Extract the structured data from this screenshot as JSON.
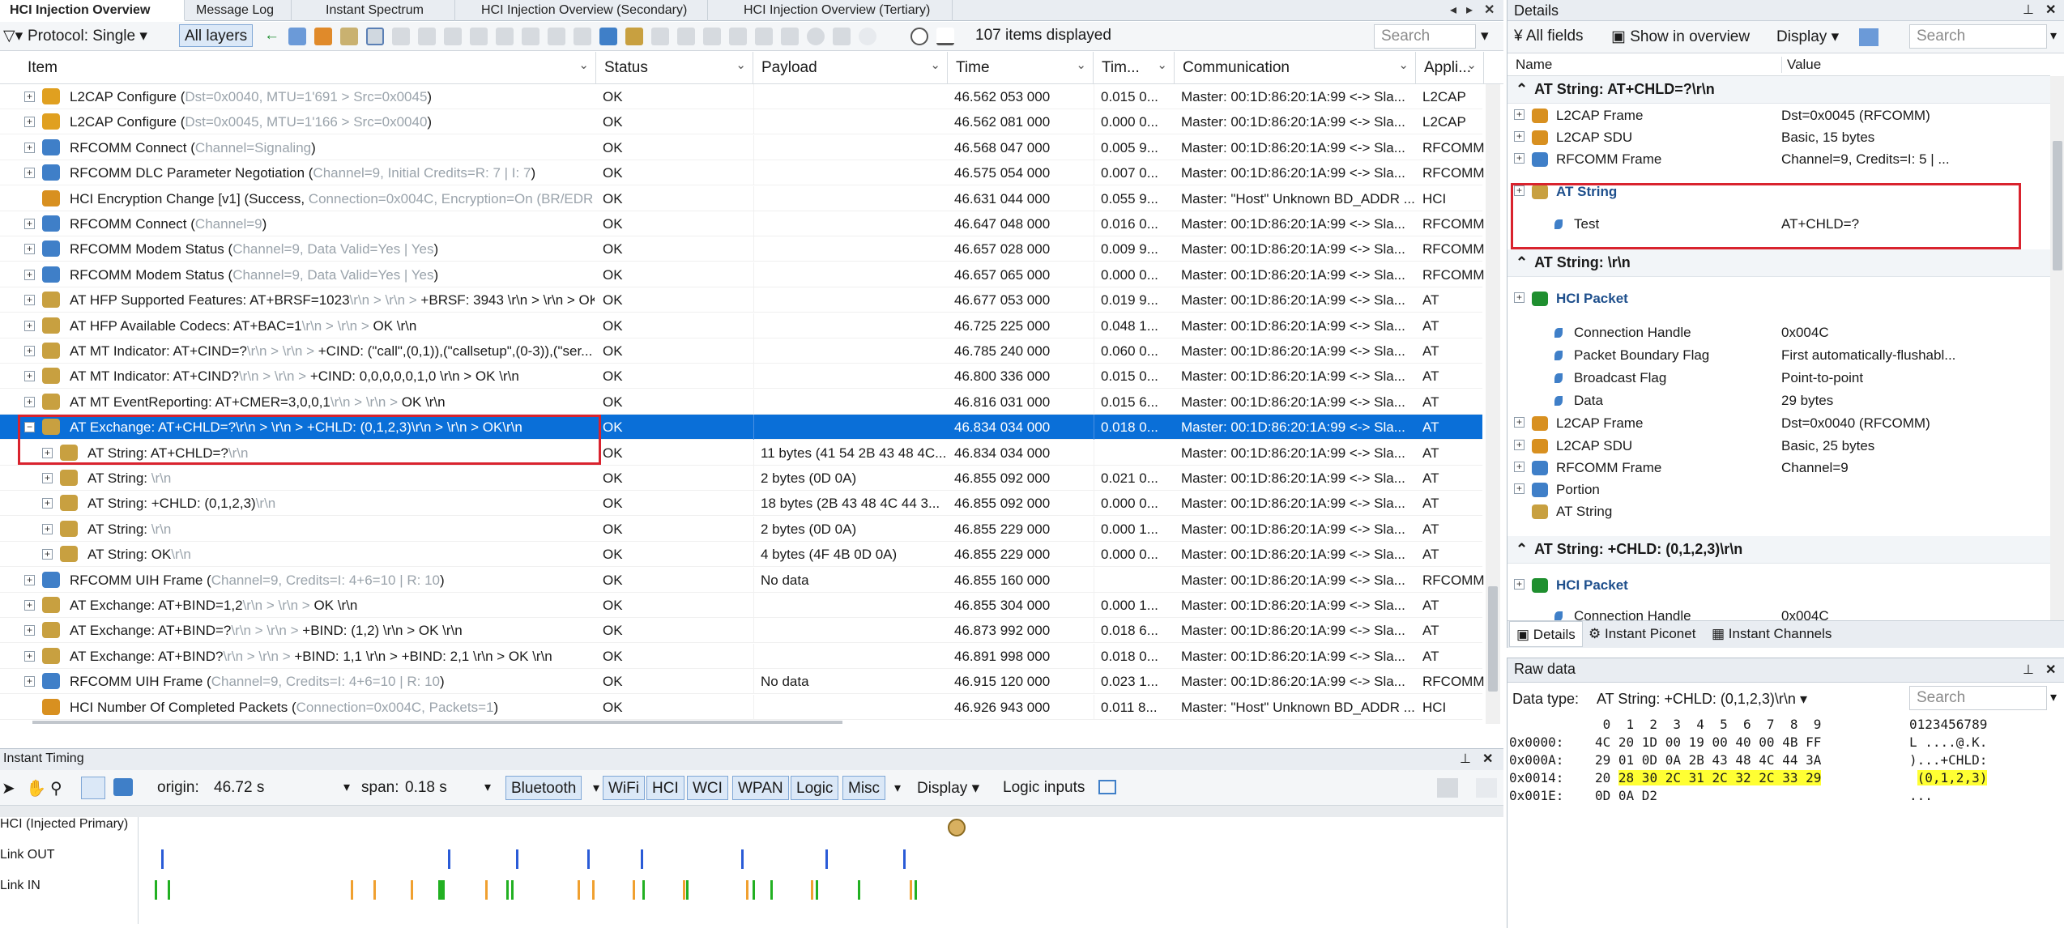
{
  "tabs": [
    {
      "label": "HCI Injection Overview",
      "active": true
    },
    {
      "label": "Message Log"
    },
    {
      "label": "Instant Spectrum"
    },
    {
      "label": "HCI Injection Overview (Secondary)"
    },
    {
      "label": "HCI Injection Overview (Tertiary)"
    }
  ],
  "toolbar": {
    "protocol_label": "Protocol: Single",
    "all_layers_label": "All layers",
    "items_displayed": "107 items displayed",
    "search_placeholder": "Search"
  },
  "grid": {
    "columns": [
      "Item",
      "Status",
      "Payload",
      "Time",
      "Tim...",
      "Communication",
      "Appli..."
    ],
    "rows": [
      {
        "item_main": "L2CAP Configure (",
        "item_detail": "Dst=0x0040, MTU=1'691 > Src=0x0045",
        "item_tail": ")",
        "status": "OK",
        "payload": "",
        "time": "46.562 053 000",
        "delta": "0.015 0...",
        "comm": "Master: 00:1D:86:20:1A:99 <-> Sla...",
        "app": "L2CAP",
        "icon": "warning-icon"
      },
      {
        "item_main": "L2CAP Configure (",
        "item_detail": "Dst=0x0045, MTU=1'166 > Src=0x0040",
        "item_tail": ")",
        "status": "OK",
        "payload": "",
        "time": "46.562 081 000",
        "delta": "0.000 0...",
        "comm": "Master: 00:1D:86:20:1A:99 <-> Sla...",
        "app": "L2CAP",
        "icon": "warning-icon"
      },
      {
        "item_main": "RFCOMM Connect (",
        "item_detail": "Channel=Signaling",
        "item_tail": ")",
        "status": "OK",
        "payload": "",
        "time": "46.568 047 000",
        "delta": "0.005 9...",
        "comm": "Master: 00:1D:86:20:1A:99 <-> Sla...",
        "app": "RFCOMM",
        "icon": "rfcomm-icon"
      },
      {
        "item_main": "RFCOMM DLC Parameter Negotiation (",
        "item_detail": "Channel=9, Initial Credits=R: 7 | I: 7",
        "item_tail": ")",
        "status": "OK",
        "payload": "",
        "time": "46.575 054 000",
        "delta": "0.007 0...",
        "comm": "Master: 00:1D:86:20:1A:99 <-> Sla...",
        "app": "RFCOMM",
        "icon": "rfcomm-icon"
      },
      {
        "item_main": "HCI Encryption Change [v1] (Success, ",
        "item_detail": "Connection=0x004C, Encryption=On (BR/EDR ...",
        "item_tail": "",
        "status": "OK",
        "payload": "",
        "time": "46.631 044 000",
        "delta": "0.055 9...",
        "comm": "Master: \"Host\" Unknown BD_ADDR ...",
        "app": "HCI",
        "icon": "hci-arrow-icon"
      },
      {
        "item_main": "RFCOMM Connect (",
        "item_detail": "Channel=9",
        "item_tail": ")",
        "status": "OK",
        "payload": "",
        "time": "46.647 048 000",
        "delta": "0.016 0...",
        "comm": "Master: 00:1D:86:20:1A:99 <-> Sla...",
        "app": "RFCOMM",
        "icon": "rfcomm-icon"
      },
      {
        "item_main": "RFCOMM Modem Status (",
        "item_detail": "Channel=9, Data Valid=Yes | Yes",
        "item_tail": ")",
        "status": "OK",
        "payload": "",
        "time": "46.657 028 000",
        "delta": "0.009 9...",
        "comm": "Master: 00:1D:86:20:1A:99 <-> Sla...",
        "app": "RFCOMM",
        "icon": "rfcomm-icon"
      },
      {
        "item_main": "RFCOMM Modem Status (",
        "item_detail": "Channel=9, Data Valid=Yes | Yes",
        "item_tail": ")",
        "status": "OK",
        "payload": "",
        "time": "46.657 065 000",
        "delta": "0.000 0...",
        "comm": "Master: 00:1D:86:20:1A:99 <-> Sla...",
        "app": "RFCOMM",
        "icon": "rfcomm-icon"
      },
      {
        "item_main": "AT HFP Supported Features: AT+BRSF=1023",
        "item_detail": "\\r\\n > \\r\\n > ",
        "item_tail": "+BRSF: 3943 \\r\\n > \\r\\n > OK \\r\\n",
        "status": "OK",
        "payload": "",
        "time": "46.677 053 000",
        "delta": "0.019 9...",
        "comm": "Master: 00:1D:86:20:1A:99 <-> Sla...",
        "app": "AT",
        "icon": "at-icon"
      },
      {
        "item_main": "AT HFP Available Codecs: AT+BAC=1",
        "item_detail": "\\r\\n > \\r\\n > ",
        "item_tail": "OK \\r\\n",
        "status": "OK",
        "payload": "",
        "time": "46.725 225 000",
        "delta": "0.048 1...",
        "comm": "Master: 00:1D:86:20:1A:99 <-> Sla...",
        "app": "AT",
        "icon": "at-icon"
      },
      {
        "item_main": "AT MT Indicator: AT+CIND=?",
        "item_detail": "\\r\\n > \\r\\n > ",
        "item_tail": "+CIND: (\"call\",(0,1)),(\"callsetup\",(0-3)),(\"ser...",
        "status": "OK",
        "payload": "",
        "time": "46.785 240 000",
        "delta": "0.060 0...",
        "comm": "Master: 00:1D:86:20:1A:99 <-> Sla...",
        "app": "AT",
        "icon": "at-icon"
      },
      {
        "item_main": "AT MT Indicator: AT+CIND?",
        "item_detail": "\\r\\n > \\r\\n > ",
        "item_tail": "+CIND: 0,0,0,0,0,1,0 \\r\\n > OK \\r\\n",
        "status": "OK",
        "payload": "",
        "time": "46.800 336 000",
        "delta": "0.015 0...",
        "comm": "Master: 00:1D:86:20:1A:99 <-> Sla...",
        "app": "AT",
        "icon": "at-icon"
      },
      {
        "item_main": "AT MT EventReporting: AT+CMER=3,0,0,1",
        "item_detail": "\\r\\n > \\r\\n > ",
        "item_tail": "OK \\r\\n",
        "status": "OK",
        "payload": "",
        "time": "46.816 031 000",
        "delta": "0.015 6...",
        "comm": "Master: 00:1D:86:20:1A:99 <-> Sla...",
        "app": "AT",
        "icon": "at-icon"
      },
      {
        "item_main": "AT Exchange: AT+CHLD=?\\r\\n > \\r\\n > +CHLD: (0,1,2,3)\\r\\n > \\r\\n > OK\\r\\n",
        "item_detail": "",
        "item_tail": "",
        "status": "OK",
        "payload": "",
        "time": "46.834 034 000",
        "delta": "0.018 0...",
        "comm": "Master: 00:1D:86:20:1A:99 <-> Sla...",
        "app": "AT",
        "icon": "at-icon",
        "selected": true,
        "expanded": true
      },
      {
        "item_main": "AT String: AT+CHLD=?",
        "item_detail": "\\r\\n",
        "item_tail": "",
        "status": "OK",
        "payload": "11 bytes (41 54 2B 43 48 4C...",
        "time": "46.834 034 000",
        "delta": "",
        "comm": "Master: 00:1D:86:20:1A:99 <-> Sla...",
        "app": "AT",
        "icon": "at-icon",
        "child": true
      },
      {
        "item_main": "AT String: ",
        "item_detail": "\\r\\n",
        "item_tail": "",
        "status": "OK",
        "payload": "2 bytes (0D 0A)",
        "time": "46.855 092 000",
        "delta": "0.021 0...",
        "comm": "Master: 00:1D:86:20:1A:99 <-> Sla...",
        "app": "AT",
        "icon": "at-icon",
        "child": true
      },
      {
        "item_main": "AT String: +CHLD: (0,1,2,3)",
        "item_detail": "\\r\\n",
        "item_tail": "",
        "status": "OK",
        "payload": "18 bytes (2B 43 48 4C 44 3...",
        "time": "46.855 092 000",
        "delta": "0.000 0...",
        "comm": "Master: 00:1D:86:20:1A:99 <-> Sla...",
        "app": "AT",
        "icon": "at-icon",
        "child": true
      },
      {
        "item_main": "AT String: ",
        "item_detail": "\\r\\n",
        "item_tail": "",
        "status": "OK",
        "payload": "2 bytes (0D 0A)",
        "time": "46.855 229 000",
        "delta": "0.000 1...",
        "comm": "Master: 00:1D:86:20:1A:99 <-> Sla...",
        "app": "AT",
        "icon": "at-icon",
        "child": true
      },
      {
        "item_main": "AT String: OK",
        "item_detail": "\\r\\n",
        "item_tail": "",
        "status": "OK",
        "payload": "4 bytes (4F 4B 0D 0A)",
        "time": "46.855 229 000",
        "delta": "0.000 0...",
        "comm": "Master: 00:1D:86:20:1A:99 <-> Sla...",
        "app": "AT",
        "icon": "at-icon",
        "child": true
      },
      {
        "item_main": "RFCOMM UIH Frame (",
        "item_detail": "Channel=9, Credits=I: 4+6=10 | R: 10",
        "item_tail": ")",
        "status": "OK",
        "payload": "No data",
        "time": "46.855 160 000",
        "delta": "",
        "comm": "Master: 00:1D:86:20:1A:99 <-> Sla...",
        "app": "RFCOMM",
        "icon": "rfcomm-icon"
      },
      {
        "item_main": "AT Exchange: AT+BIND=1,2",
        "item_detail": "\\r\\n > \\r\\n > ",
        "item_tail": "OK \\r\\n",
        "status": "OK",
        "payload": "",
        "time": "46.855 304 000",
        "delta": "0.000 1...",
        "comm": "Master: 00:1D:86:20:1A:99 <-> Sla...",
        "app": "AT",
        "icon": "at-icon"
      },
      {
        "item_main": "AT Exchange: AT+BIND=?",
        "item_detail": "\\r\\n > \\r\\n > ",
        "item_tail": "+BIND: (1,2) \\r\\n > OK \\r\\n",
        "status": "OK",
        "payload": "",
        "time": "46.873 992 000",
        "delta": "0.018 6...",
        "comm": "Master: 00:1D:86:20:1A:99 <-> Sla...",
        "app": "AT",
        "icon": "at-icon"
      },
      {
        "item_main": "AT Exchange: AT+BIND?",
        "item_detail": "\\r\\n > \\r\\n > ",
        "item_tail": "+BIND: 1,1 \\r\\n > +BIND: 2,1 \\r\\n > OK \\r\\n",
        "status": "OK",
        "payload": "",
        "time": "46.891 998 000",
        "delta": "0.018 0...",
        "comm": "Master: 00:1D:86:20:1A:99 <-> Sla...",
        "app": "AT",
        "icon": "at-icon"
      },
      {
        "item_main": "RFCOMM UIH Frame (",
        "item_detail": "Channel=9, Credits=I: 4+6=10 | R: 10",
        "item_tail": ")",
        "status": "OK",
        "payload": "No data",
        "time": "46.915 120 000",
        "delta": "0.023 1...",
        "comm": "Master: 00:1D:86:20:1A:99 <-> Sla...",
        "app": "RFCOMM",
        "icon": "rfcomm-icon"
      },
      {
        "item_main": "HCI Number Of Completed Packets (",
        "item_detail": "Connection=0x004C, Packets=1",
        "item_tail": ")",
        "status": "OK",
        "payload": "",
        "time": "46.926 943 000",
        "delta": "0.011 8...",
        "comm": "Master: \"Host\" Unknown BD_ADDR ...",
        "app": "HCI",
        "icon": "hci-arrow-icon"
      }
    ]
  },
  "timing": {
    "title": "Instant Timing",
    "origin_label": "origin:",
    "origin_value": "46.72 s",
    "span_label": "span:",
    "span_value": "0.18 s",
    "layers": [
      "Bluetooth",
      "WiFi",
      "HCI",
      "WCI",
      "WPAN",
      "Logic",
      "Misc"
    ],
    "display_label": "Display",
    "logic_inputs_label": "Logic inputs",
    "tracks": [
      "HCI (Injected Primary)",
      "Link OUT",
      "Link IN"
    ],
    "colors": {
      "out": "#2a5bd7",
      "in_orange": "#f0a030",
      "in_green": "#22b022"
    }
  },
  "details": {
    "title": "Details",
    "all_fields": "All fields",
    "show_overview": "Show in overview",
    "display": "Display",
    "search_placeholder": "Search",
    "col_name": "Name",
    "col_value": "Value",
    "sec1": "AT String: AT+CHLD=?\\r\\n",
    "sec1_rows": [
      {
        "name": "L2CAP Frame",
        "value": "Dst=0x0045 (RFCOMM)"
      },
      {
        "name": "L2CAP SDU",
        "value": "Basic, 15 bytes"
      },
      {
        "name": "RFCOMM Frame",
        "value": "Channel=9, Credits=I: 5 | ..."
      }
    ],
    "at_string_label": "AT String",
    "test_name": "Test",
    "test_value": "AT+CHLD=?",
    "sec2": "AT String: \\r\\n",
    "hci_packet": "HCI Packet",
    "sec2_rows": [
      {
        "name": "Connection Handle",
        "value": "0x004C"
      },
      {
        "name": "Packet Boundary Flag",
        "value": "First automatically-flushabl..."
      },
      {
        "name": "Broadcast Flag",
        "value": "Point-to-point"
      },
      {
        "name": "Data",
        "value": "29 bytes"
      }
    ],
    "sec2_rows2": [
      {
        "name": "L2CAP Frame",
        "value": "Dst=0x0040 (RFCOMM)"
      },
      {
        "name": "L2CAP SDU",
        "value": "Basic, 25 bytes"
      },
      {
        "name": "RFCOMM Frame",
        "value": "Channel=9"
      },
      {
        "name": "Portion",
        "value": ""
      },
      {
        "name": "AT String",
        "value": ""
      }
    ],
    "sec3": "AT String: +CHLD: (0,1,2,3)\\r\\n",
    "hci_packet2": "HCI Packet",
    "cut_name": "Connection Handle",
    "cut_value": "0x004C",
    "bottom_tabs": [
      "Details",
      "Instant Piconet",
      "Instant Channels"
    ]
  },
  "raw": {
    "title": "Raw data",
    "data_type_label": "Data type:",
    "data_type_value": "AT String: +CHLD: (0,1,2,3)\\r\\n",
    "search_placeholder": "Search",
    "header_cols": " 0  1  2  3  4  5  6  7  8  9",
    "ascii_header": "0123456789",
    "rows": [
      {
        "offset": "0x0000:",
        "hex": "4C 20 1D 00 19 00 40 00 4B FF",
        "ascii": "L ....@.K."
      },
      {
        "offset": "0x000A:",
        "hex": "29 01 0D 0A 2B 43 48 4C 44 3A",
        "ascii": ")...+CHLD:"
      },
      {
        "offset": "0x0014:",
        "hex_plain": "20 ",
        "hex_hl": "28 30 2C 31 2C 32 2C 33 29",
        "ascii_plain": " ",
        "ascii_hl": "(0,1,2,3)"
      },
      {
        "offset": "0x001E:",
        "hex": "0D 0A D2",
        "ascii": "..."
      }
    ]
  }
}
